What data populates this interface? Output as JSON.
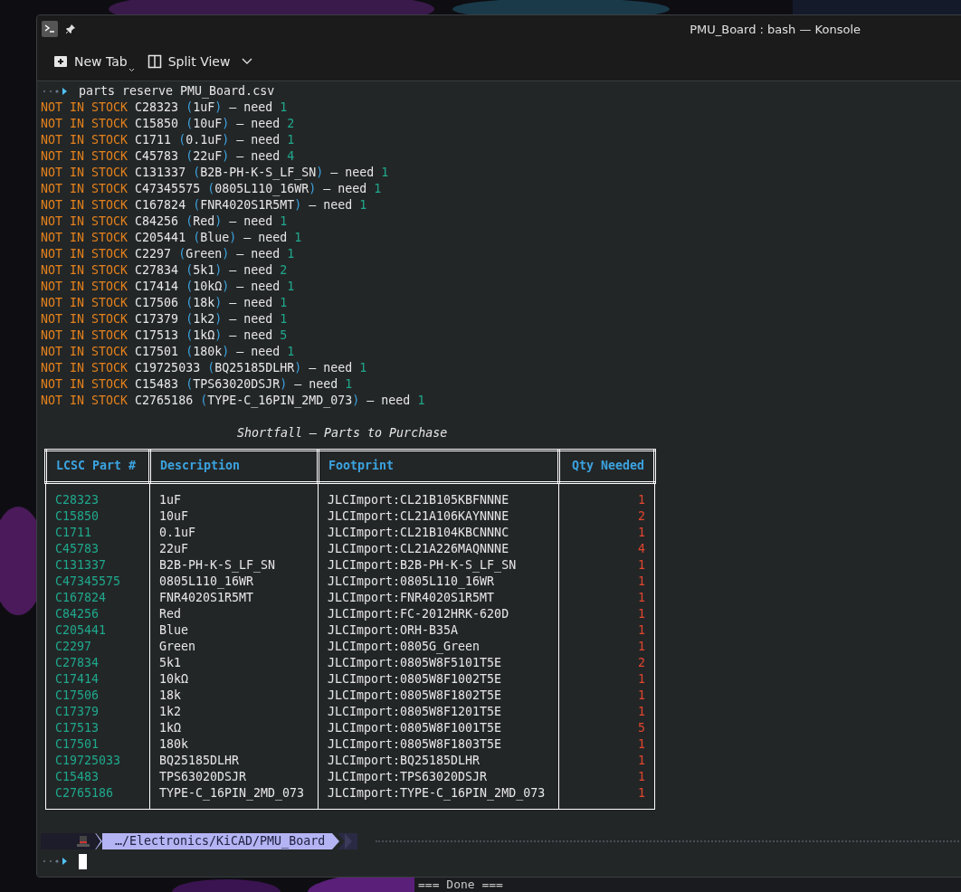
{
  "window": {
    "title": "PMU_Board : bash — Konsole"
  },
  "toolbar": [
    {
      "label": "New Tab",
      "kind": "new-tab"
    },
    {
      "label": "Split View",
      "kind": "split-view"
    }
  ],
  "command": "parts reserve PMU_Board.csv",
  "lines": [
    {
      "status": "NOT IN STOCK",
      "part": "C28323",
      "open": "(",
      "description": "1uF",
      "close": ")",
      "need": "— need",
      "qty": "1"
    },
    {
      "status": "NOT IN STOCK",
      "part": "C15850",
      "open": "(",
      "description": "10uF",
      "close": ")",
      "need": "— need",
      "qty": "2"
    },
    {
      "status": "NOT IN STOCK",
      "part": "C1711",
      "open": "(",
      "description": "0.1uF",
      "close": ")",
      "need": "— need",
      "qty": "1"
    },
    {
      "status": "NOT IN STOCK",
      "part": "C45783",
      "open": "(",
      "description": "22uF",
      "close": ")",
      "need": "— need",
      "qty": "4"
    },
    {
      "status": "NOT IN STOCK",
      "part": "C131337",
      "open": "(",
      "description": "B2B-PH-K-S_LF_SN",
      "close": ")",
      "need": "— need",
      "qty": "1"
    },
    {
      "status": "NOT IN STOCK",
      "part": "C47345575",
      "open": "(",
      "description": "0805L110_16WR",
      "close": ")",
      "need": "— need",
      "qty": "1"
    },
    {
      "status": "NOT IN STOCK",
      "part": "C167824",
      "open": "(",
      "description": "FNR4020S1R5MT",
      "close": ")",
      "need": "— need",
      "qty": "1"
    },
    {
      "status": "NOT IN STOCK",
      "part": "C84256",
      "open": "(",
      "description": "Red",
      "close": ")",
      "need": "— need",
      "qty": "1"
    },
    {
      "status": "NOT IN STOCK",
      "part": "C205441",
      "open": "(",
      "description": "Blue",
      "close": ")",
      "need": "— need",
      "qty": "1"
    },
    {
      "status": "NOT IN STOCK",
      "part": "C2297",
      "open": "(",
      "description": "Green",
      "close": ")",
      "need": "— need",
      "qty": "1"
    },
    {
      "status": "NOT IN STOCK",
      "part": "C27834",
      "open": "(",
      "description": "5k1",
      "close": ")",
      "need": "— need",
      "qty": "2"
    },
    {
      "status": "NOT IN STOCK",
      "part": "C17414",
      "open": "(",
      "description": "10kΩ",
      "close": ")",
      "need": "— need",
      "qty": "1"
    },
    {
      "status": "NOT IN STOCK",
      "part": "C17506",
      "open": "(",
      "description": "18k",
      "close": ")",
      "need": "— need",
      "qty": "1"
    },
    {
      "status": "NOT IN STOCK",
      "part": "C17379",
      "open": "(",
      "description": "1k2",
      "close": ")",
      "need": "— need",
      "qty": "1"
    },
    {
      "status": "NOT IN STOCK",
      "part": "C17513",
      "open": "(",
      "description": "1kΩ",
      "close": ")",
      "need": "— need",
      "qty": "5"
    },
    {
      "status": "NOT IN STOCK",
      "part": "C17501",
      "open": "(",
      "description": "180k",
      "close": ")",
      "need": "— need",
      "qty": "1"
    },
    {
      "status": "NOT IN STOCK",
      "part": "C19725033",
      "open": "(",
      "description": "BQ25185DLHR",
      "close": ")",
      "need": "— need",
      "qty": "1"
    },
    {
      "status": "NOT IN STOCK",
      "part": "C15483",
      "open": "(",
      "description": "TPS63020DSJR",
      "close": ")",
      "need": "— need",
      "qty": "1"
    },
    {
      "status": "NOT IN STOCK",
      "part": "C2765186",
      "open": "(",
      "description": "TYPE-C_16PIN_2MD_073",
      "close": ")",
      "need": "— need",
      "qty": "1"
    }
  ],
  "table": {
    "title": "Shortfall — Parts to Purchase",
    "columns": [
      "LCSC Part #",
      "Description",
      "Footprint",
      "Qty Needed"
    ],
    "rows": [
      [
        "C28323",
        "1uF",
        "JLCImport:CL21B105KBFNNNE",
        "1"
      ],
      [
        "C15850",
        "10uF",
        "JLCImport:CL21A106KAYNNNE",
        "2"
      ],
      [
        "C1711",
        "0.1uF",
        "JLCImport:CL21B104KBCNNNC",
        "1"
      ],
      [
        "C45783",
        "22uF",
        "JLCImport:CL21A226MAQNNNE",
        "4"
      ],
      [
        "C131337",
        "B2B-PH-K-S_LF_SN",
        "JLCImport:B2B-PH-K-S_LF_SN",
        "1"
      ],
      [
        "C47345575",
        "0805L110_16WR",
        "JLCImport:0805L110_16WR",
        "1"
      ],
      [
        "C167824",
        "FNR4020S1R5MT",
        "JLCImport:FNR4020S1R5MT",
        "1"
      ],
      [
        "C84256",
        "Red",
        "JLCImport:FC-2012HRK-620D",
        "1"
      ],
      [
        "C205441",
        "Blue",
        "JLCImport:ORH-B35A",
        "1"
      ],
      [
        "C2297",
        "Green",
        "JLCImport:0805G_Green",
        "1"
      ],
      [
        "C27834",
        "5k1",
        "JLCImport:0805W8F5101T5E",
        "2"
      ],
      [
        "C17414",
        "10kΩ",
        "JLCImport:0805W8F1002T5E",
        "1"
      ],
      [
        "C17506",
        "18k",
        "JLCImport:0805W8F1802T5E",
        "1"
      ],
      [
        "C17379",
        "1k2",
        "JLCImport:0805W8F1201T5E",
        "1"
      ],
      [
        "C17513",
        "1kΩ",
        "JLCImport:0805W8F1001T5E",
        "5"
      ],
      [
        "C17501",
        "180k",
        "JLCImport:0805W8F1803T5E",
        "1"
      ],
      [
        "C19725033",
        "BQ25185DLHR",
        "JLCImport:BQ25185DLHR",
        "1"
      ],
      [
        "C15483",
        "TPS63020DSJR",
        "JLCImport:TPS63020DSJR",
        "1"
      ],
      [
        "C2765186",
        "TYPE-C_16PIN_2MD_073",
        "JLCImport:TYPE-C_16PIN_2MD_073",
        "1"
      ]
    ]
  },
  "prompt_path": "…/Electronics/KiCAD/PMU_Board",
  "background_text": "=== Done ==="
}
